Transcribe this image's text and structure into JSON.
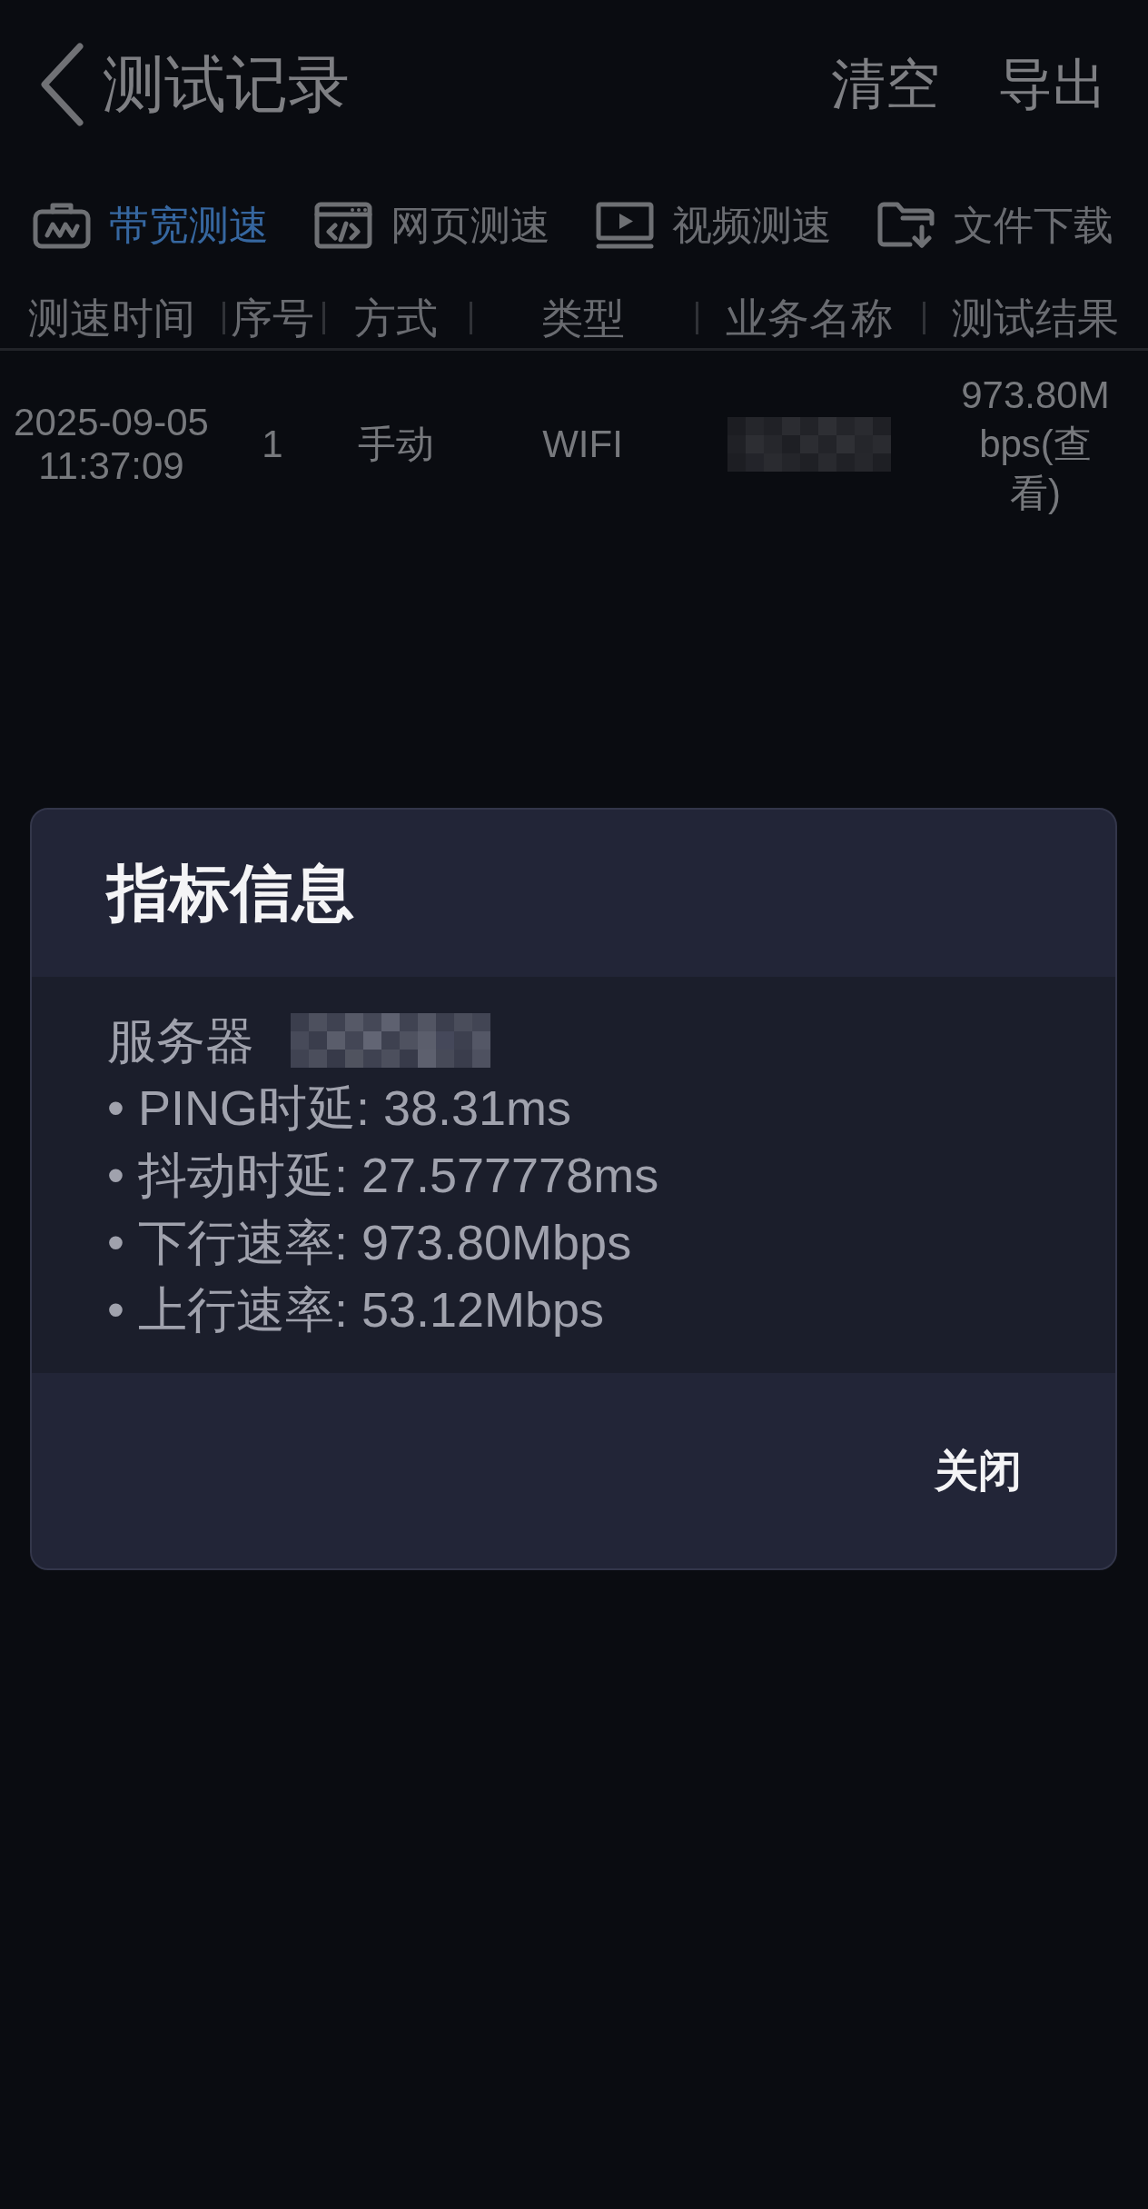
{
  "header": {
    "title": "测试记录",
    "actions": [
      "清空",
      "导出"
    ]
  },
  "tabs": [
    {
      "label": "带宽测速",
      "selected": true
    },
    {
      "label": "网页测速",
      "selected": false
    },
    {
      "label": "视频测速",
      "selected": false
    },
    {
      "label": "文件下载",
      "selected": false
    }
  ],
  "table": {
    "columns": [
      "测速时间",
      "序号",
      "方式",
      "类型",
      "业务名称",
      "测试结果"
    ],
    "rows": [
      {
        "time": "2025-09-05 11:37:09",
        "number": "1",
        "method": "手动",
        "type": "WIFI",
        "service_name": {
          "redacted": true
        },
        "result": "973.80Mbps(查看)"
      }
    ]
  },
  "dialog": {
    "title": "指标信息",
    "server": {
      "label": "服务器",
      "redacted": true
    },
    "lines": [
      "• PING时延: 38.31ms",
      "• 抖动时延: 27.577778ms",
      "• 下行速率: 973.80Mbps",
      "• 上行速率: 53.12Mbps"
    ],
    "button": "关闭"
  }
}
